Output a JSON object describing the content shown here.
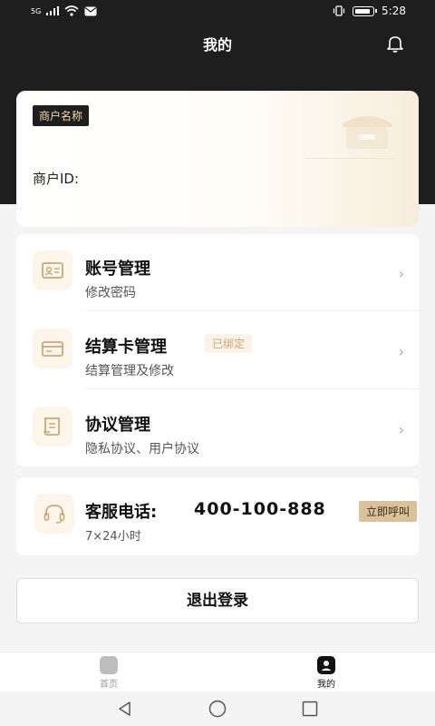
{
  "status_bar": {
    "signal": "5G",
    "time": "5:28"
  },
  "header": {
    "title": "我的",
    "notification_icon": "bell-icon"
  },
  "merchant": {
    "name_tag": "商户名称",
    "id_label": "商户ID:"
  },
  "menu": {
    "items": [
      {
        "title": "账号管理",
        "subtitle": "修改密码",
        "icon": "id-card-icon"
      },
      {
        "title": "结算卡管理",
        "subtitle": "结算管理及修改",
        "badge": "已绑定",
        "icon": "bank-card-icon"
      },
      {
        "title": "协议管理",
        "subtitle": "隐私协议、用户协议",
        "icon": "document-icon"
      }
    ]
  },
  "service": {
    "label": "客服电话:",
    "phone": "400-100-888",
    "hours": "7×24小时",
    "call_button": "立即呼叫",
    "icon": "headset-icon"
  },
  "logout": {
    "label": "退出登录"
  },
  "tab_bar": {
    "tabs": [
      {
        "label": "首页",
        "active": false
      },
      {
        "label": "我的",
        "active": true
      }
    ]
  },
  "colors": {
    "header_bg": "#1e1e1e",
    "accent_gold": "#d9c29a",
    "tag_text": "#f0d9a8"
  }
}
